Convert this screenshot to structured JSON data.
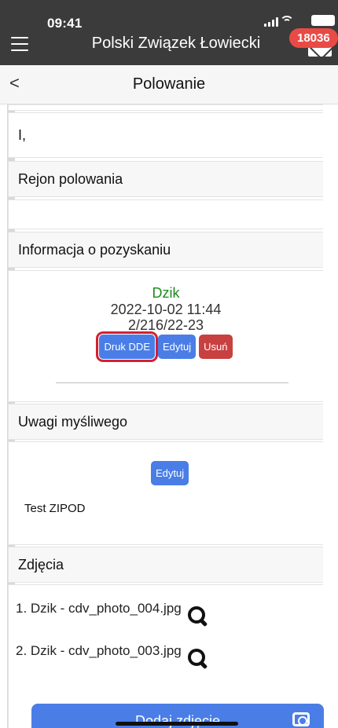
{
  "status": {
    "time": "09:41"
  },
  "appbar": {
    "title": "Polski Związek Łowiecki",
    "badge": "18036"
  },
  "subheader": {
    "back": "<",
    "title": "Polowanie"
  },
  "sections": {
    "top_value": "I,",
    "rejon_header": "Rejon polowania",
    "rejon_value": "",
    "info_header": "Informacja o pozyskaniu",
    "game": {
      "name": "Dzik",
      "datetime": "2022-10-02 11:44",
      "number": "2/216/22-23",
      "buttons": {
        "print": "Druk DDE",
        "edit": "Edytuj",
        "delete": "Usuń"
      }
    },
    "uwagi_header": "Uwagi myśliwego",
    "uwagi_edit": "Edytuj",
    "uwagi_text": "Test ZIPOD",
    "photos_header": "Zdjęcia",
    "photos": [
      "1. Dzik - cdv_photo_004.jpg",
      "2. Dzik - cdv_photo_003.jpg"
    ],
    "add_photo": "Dodaj zdjęcie"
  },
  "colors": {
    "appbar": "#3b3b3b",
    "badge": "#e84b45",
    "primary_button": "#4a7ee6",
    "danger_button": "#c84040",
    "game_name": "#1e8a1e",
    "highlight_outline": "#d4202e"
  }
}
